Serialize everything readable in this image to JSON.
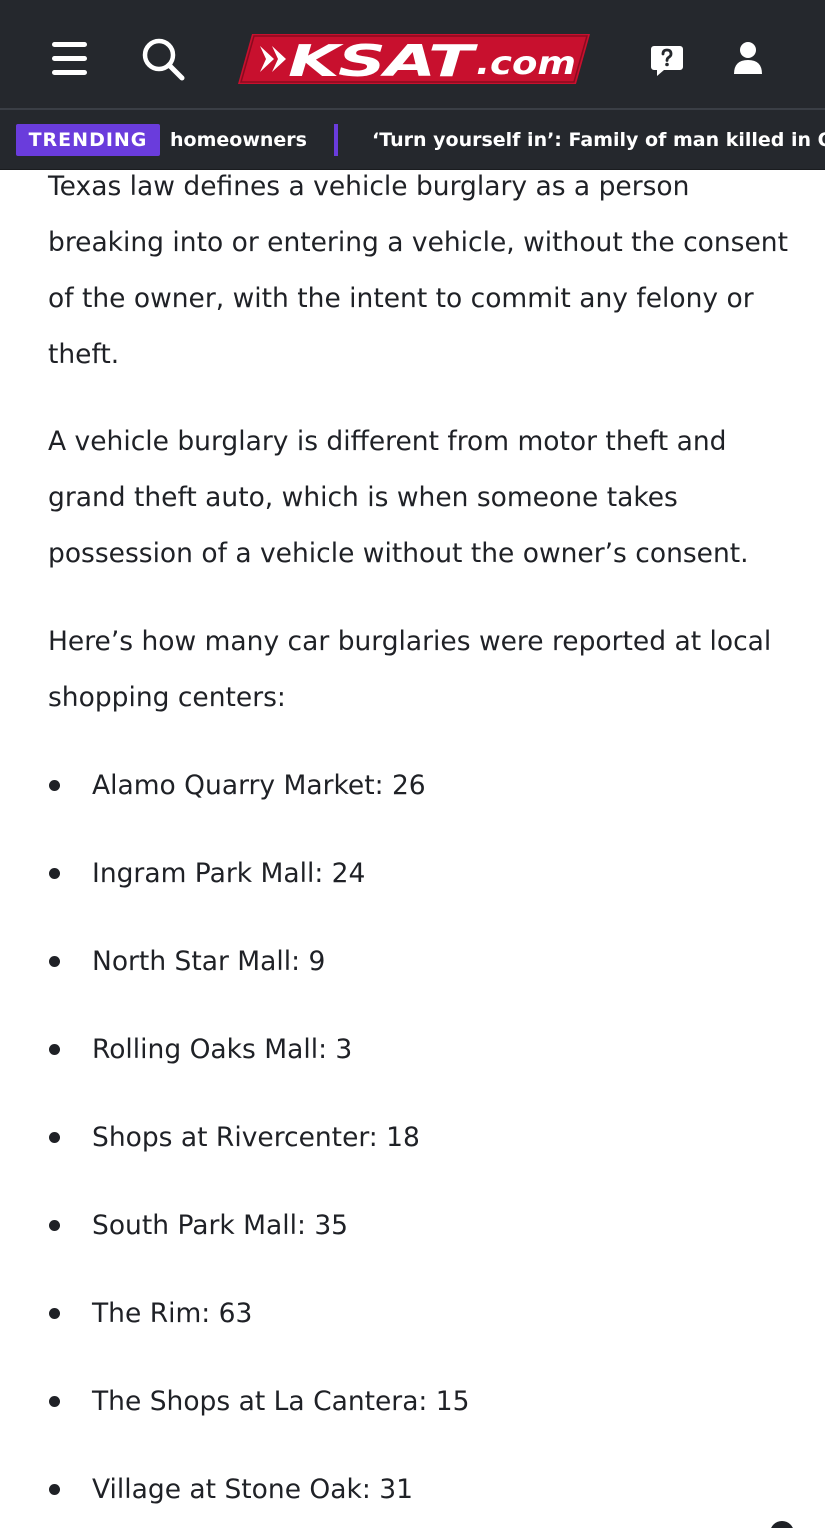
{
  "header": {
    "logo_text": "KSAT",
    "logo_suffix": ".com",
    "colors": {
      "background": "#25282d",
      "logo_red": "#c8102e",
      "accent_purple": "#6a3cdc"
    },
    "icons": [
      "menu-icon",
      "search-icon",
      "help-icon",
      "user-icon"
    ]
  },
  "trending": {
    "badge_label": "TRENDING",
    "items": [
      "homeowners",
      "‘Turn yourself in’: Family of man killed in Old"
    ]
  },
  "article": {
    "paragraphs": [
      "Texas law defines a vehicle burglary as a person breaking into or entering a vehicle, without the consent of the owner, with the intent to commit any felony or theft.",
      "A vehicle burglary is different from motor theft and grand theft auto, which is when someone takes possession of a vehicle without the owner’s consent.",
      "Here’s how many car burglaries were reported at local shopping centers:"
    ],
    "list_items": [
      "Alamo Quarry Market: 26",
      "Ingram Park Mall: 24",
      "North Star Mall: 9",
      "Rolling Oaks Mall: 3",
      "Shops at Rivercenter: 18",
      "South Park Mall: 35",
      "The Rim: 63",
      "The Shops at La Cantera: 15",
      "Village at Stone Oak: 31"
    ]
  }
}
